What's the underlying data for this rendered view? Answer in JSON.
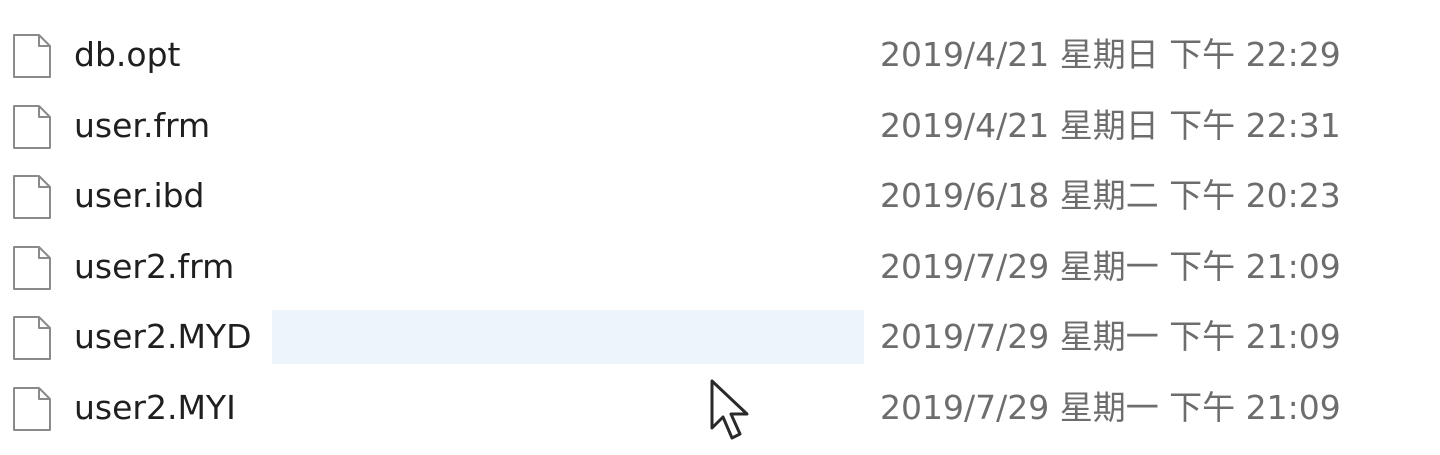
{
  "files": [
    {
      "name": "db.opt",
      "modified": "2019/4/21 星期日 下午 22:29",
      "icon": "file-icon"
    },
    {
      "name": "user.frm",
      "modified": "2019/4/21 星期日 下午 22:31",
      "icon": "file-icon"
    },
    {
      "name": "user.ibd",
      "modified": "2019/6/18 星期二 下午 20:23",
      "icon": "file-icon"
    },
    {
      "name": "user2.frm",
      "modified": "2019/7/29 星期一 下午 21:09",
      "icon": "file-icon"
    },
    {
      "name": "user2.MYD",
      "modified": "2019/7/29 星期一 下午 21:09",
      "icon": "file-icon",
      "hovered": true
    },
    {
      "name": "user2.MYI",
      "modified": "2019/7/29 星期一 下午 21:09",
      "icon": "file-icon"
    }
  ],
  "colors": {
    "hover": "#eef4fc",
    "name_text": "#1f1f1f",
    "date_text": "#6d6d6d"
  },
  "cursor": {
    "icon": "mouse-pointer-icon"
  }
}
